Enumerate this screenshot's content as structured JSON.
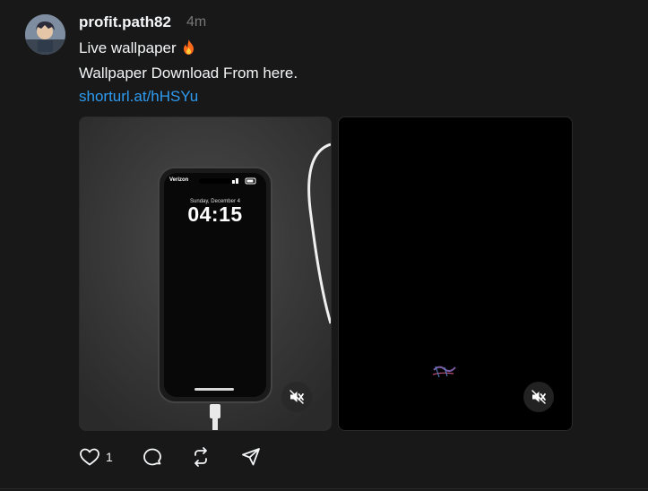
{
  "post": {
    "username": "profit.path82",
    "time": "4m",
    "text_line1": "Live wallpaper",
    "text_line2": "Wallpaper Download From here.",
    "link": "shorturl.at/hHSYu"
  },
  "media": {
    "image1": {
      "carrier": "Verizon",
      "date": "Sunday, December 4",
      "time": "04:15"
    }
  },
  "actions": {
    "like_count": "1"
  },
  "colors": {
    "background": "#181818",
    "text": "#f3f5f7",
    "link": "#2e9bf0",
    "muted": "#777777"
  },
  "icons": [
    "fire-emoji-icon",
    "mute-icon",
    "heart-icon",
    "comment-icon",
    "repost-icon",
    "share-icon"
  ]
}
